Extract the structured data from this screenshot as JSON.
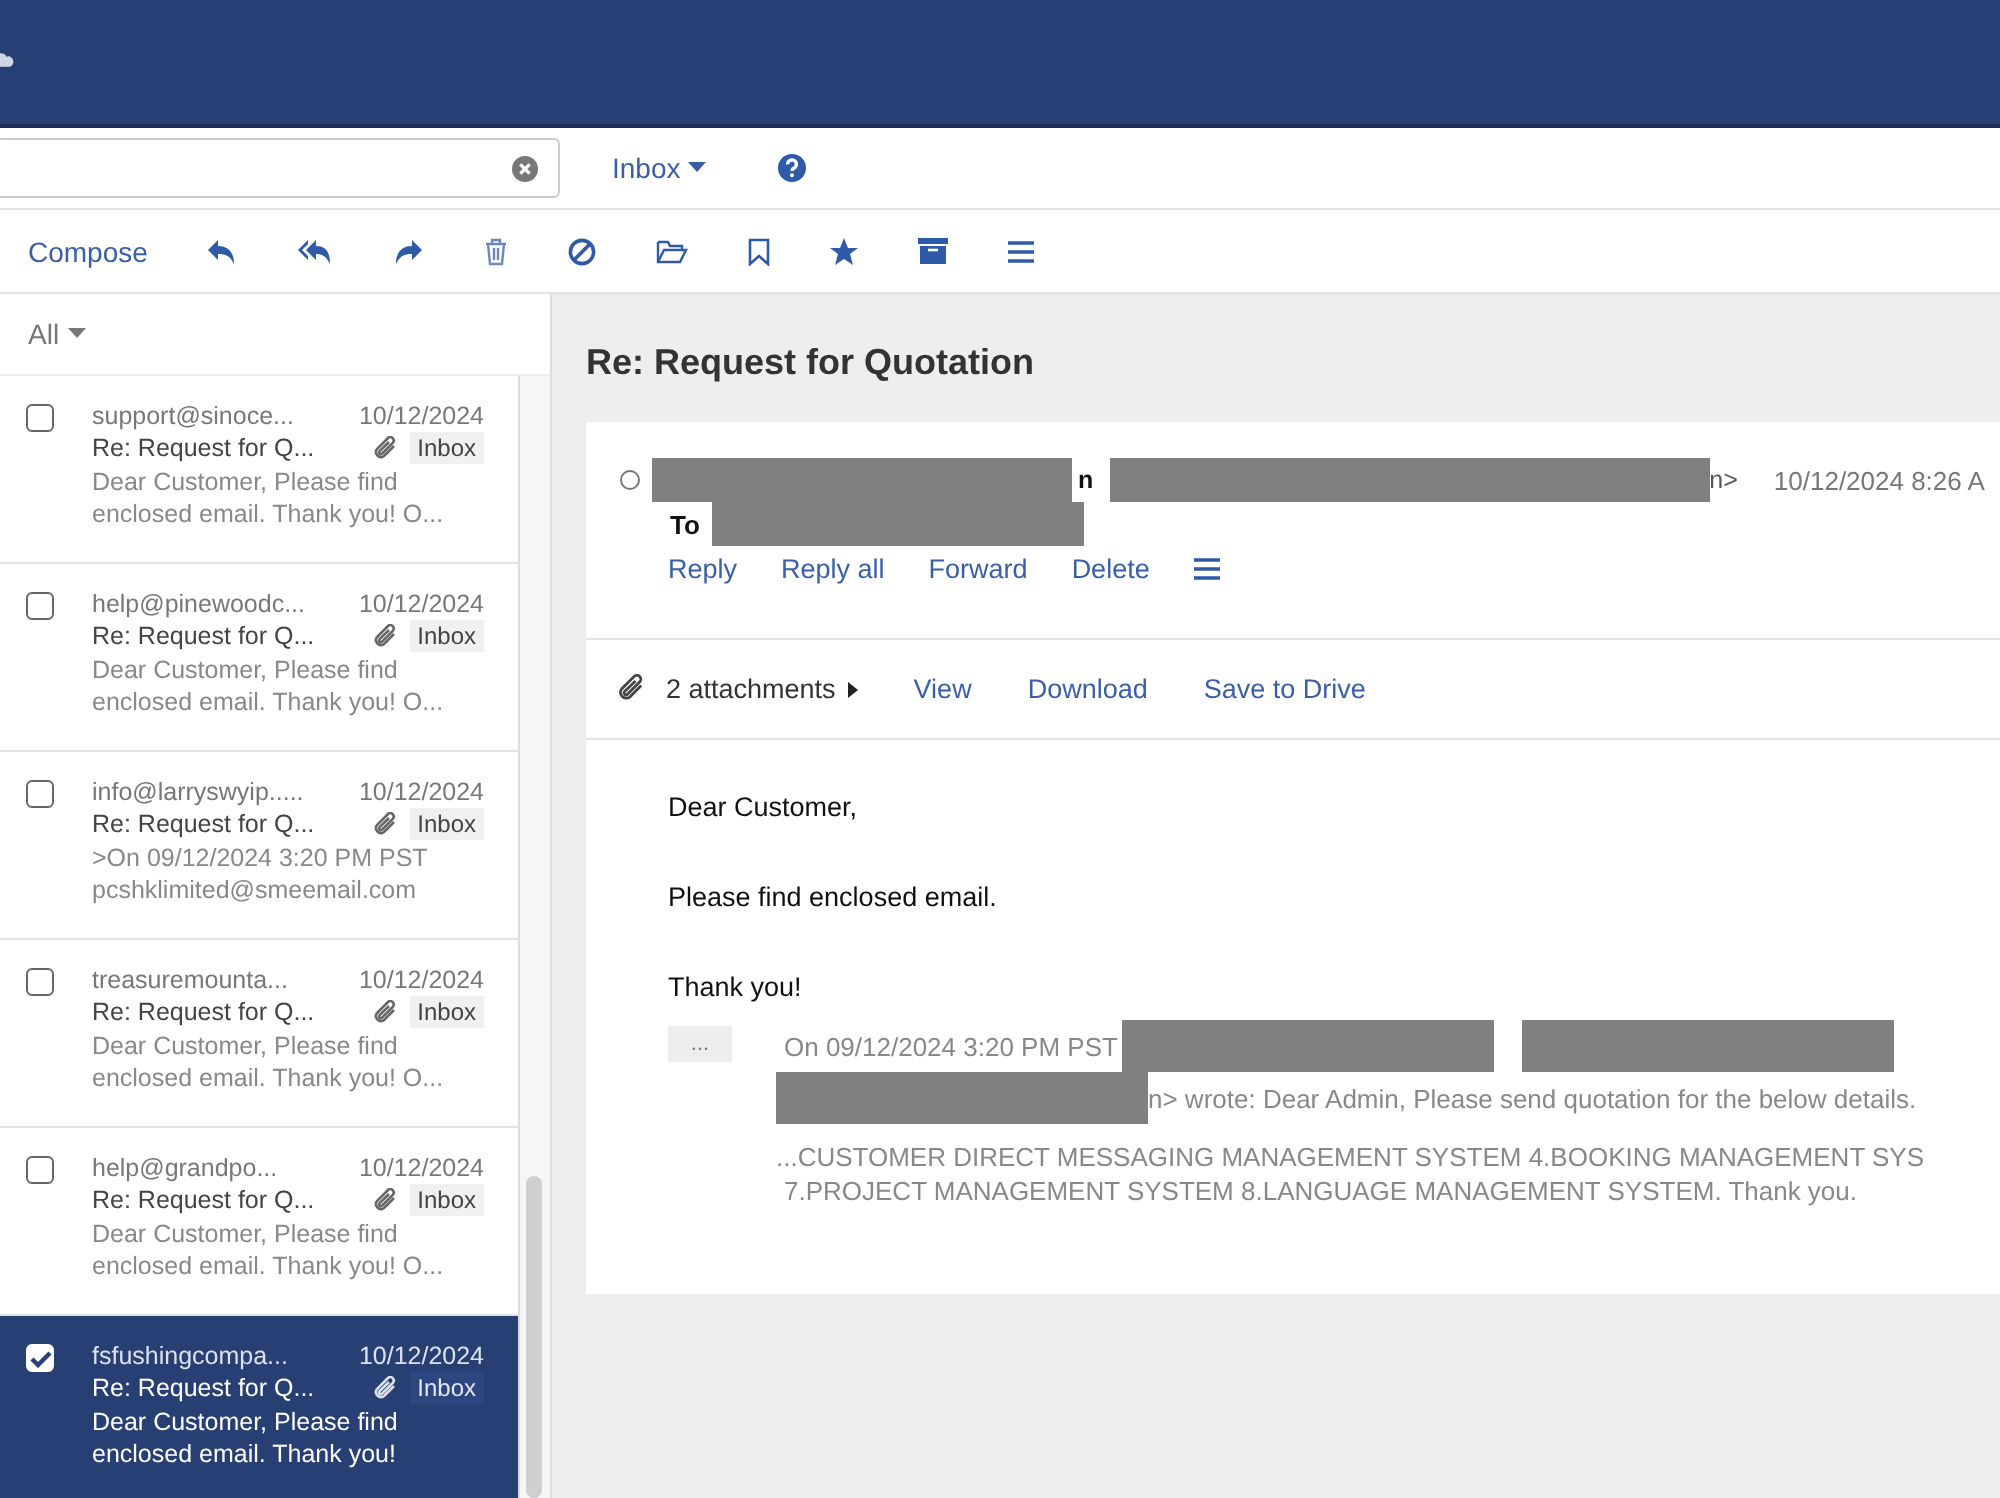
{
  "folder_menu": {
    "label": "Inbox"
  },
  "toolbar": {
    "compose": "Compose"
  },
  "filter": {
    "label": "All"
  },
  "messages": [
    {
      "sender": "support@sinoce...",
      "date": "10/12/2024",
      "subject": "Re: Request for Q...",
      "attachment": true,
      "folder": "Inbox",
      "preview": "Dear Customer, Please find enclosed email. Thank you! O...",
      "selected": false
    },
    {
      "sender": "help@pinewoodc...",
      "date": "10/12/2024",
      "subject": "Re: Request for Q...",
      "attachment": true,
      "folder": "Inbox",
      "preview": "Dear Customer, Please find enclosed email. Thank you! O...",
      "selected": false
    },
    {
      "sender": "info@larryswyip.....",
      "date": "10/12/2024",
      "subject": "Re: Request for Q...",
      "attachment": true,
      "folder": "Inbox",
      "preview": ">On 09/12/2024 3:20 PM PST pcshklimited@smeemail.com",
      "selected": false
    },
    {
      "sender": "treasuremounta...",
      "date": "10/12/2024",
      "subject": "Re: Request for Q...",
      "attachment": true,
      "folder": "Inbox",
      "preview": "Dear Customer, Please find enclosed email. Thank you! O...",
      "selected": false
    },
    {
      "sender": "help@grandpo...",
      "date": "10/12/2024",
      "subject": "Re: Request for Q...",
      "attachment": true,
      "folder": "Inbox",
      "preview": "Dear Customer, Please find enclosed email. Thank you! O...",
      "selected": false
    },
    {
      "sender": "fsfushingcompa...",
      "date": "10/12/2024",
      "subject": "Re: Request for Q...",
      "attachment": true,
      "folder": "Inbox",
      "preview": "Dear Customer, Please find enclosed email. Thank you!",
      "selected": true
    }
  ],
  "message_view": {
    "title": "Re: Request for Quotation",
    "from_fragment": "n",
    "address_fragment": "n>",
    "date": "10/12/2024 8:26 A",
    "to_label": "To",
    "actions": [
      "Reply",
      "Reply all",
      "Forward",
      "Delete"
    ],
    "attachments": {
      "label": "2 attachments",
      "actions": [
        "View",
        "Download",
        "Save to Drive"
      ]
    },
    "body": [
      "Dear Customer,",
      "Please find enclosed email.",
      "Thank you!"
    ],
    "quote_toggle": "...",
    "quote": {
      "intro": "On 09/12/2024 3:20 PM PST",
      "line_2": "n> wrote: Dear Admin, Please send quotation for the below details.",
      "line_3": "...CUSTOMER DIRECT MESSAGING MANAGEMENT SYSTEM 4.BOOKING MANAGEMENT SYS",
      "line_4": "7.PROJECT MANAGEMENT SYSTEM 8.LANGUAGE MANAGEMENT SYSTEM. Thank you."
    }
  }
}
